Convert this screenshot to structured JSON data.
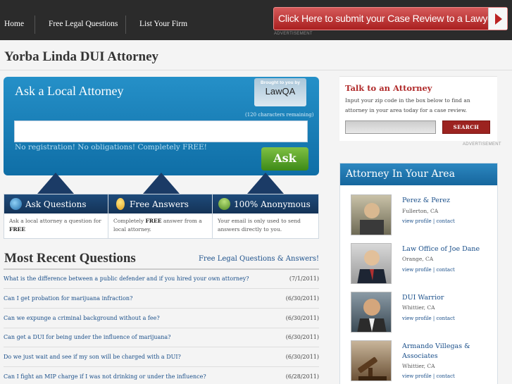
{
  "nav": {
    "items": [
      "Home",
      "Free Legal Questions",
      "List Your Firm"
    ],
    "cta_label": "Click Here to submit your Case Review to a Lawyer",
    "ad_label": "ADVERTISEMENT"
  },
  "page_title": "Yorba Linda DUI Attorney",
  "ask": {
    "heading": "Ask a Local Attorney",
    "brought_by": "Brought to you by",
    "brand": "LawQA",
    "chars_remaining": "(120 characters remaining)",
    "input_placeholder": "",
    "no_reg": "No registration! No obligations! Completely FREE!",
    "button": "Ask"
  },
  "features": [
    {
      "title": "Ask Questions",
      "body_pre": "Ask a local attorney a question for ",
      "body_bold": "FREE",
      "body_post": ""
    },
    {
      "title": "Free Answers",
      "body_pre": "Completely ",
      "body_bold": "FREE",
      "body_post": " answer from a local attorney."
    },
    {
      "title": "100% Anonymous",
      "body_pre": "Your email is only used to send answers directly to you.",
      "body_bold": "",
      "body_post": ""
    }
  ],
  "recent": {
    "heading": "Most Recent Questions",
    "link": "Free Legal Questions & Answers!",
    "questions": [
      {
        "text": "What is the difference between a public defender and if you hired your own attorney?",
        "date": "(7/1/2011)"
      },
      {
        "text": "Can I get probation for marijuana infraction?",
        "date": "(6/30/2011)"
      },
      {
        "text": "Can we expunge a criminal background without a fee?",
        "date": "(6/30/2011)"
      },
      {
        "text": "Can get a DUI for being under the influence of marijuana?",
        "date": "(6/30/2011)"
      },
      {
        "text": "Do we just wait and see if my son will be charged with a DUI?",
        "date": "(6/30/2011)"
      },
      {
        "text": "Can I fight an MIP charge if I was not drinking or under the influence?",
        "date": "(6/28/2011)"
      }
    ]
  },
  "talk": {
    "heading": "Talk to an Attorney",
    "text": "Input your zip code in the box below to find an attorney in your area today for a case review.",
    "zip_placeholder": "",
    "search_label": "SEARCH",
    "ad_label": "ADVERTISEMENT"
  },
  "area": {
    "heading": "Attorney In Your Area",
    "attorneys": [
      {
        "name": "Perez & Perez",
        "city": "Fullerton, CA",
        "links": "view profile | contact"
      },
      {
        "name": "Law Office of Joe Dane",
        "city": "Orange, CA",
        "links": "view profile | contact"
      },
      {
        "name": "DUI Warrior",
        "city": "Whittier, CA",
        "links": "view profile | contact"
      },
      {
        "name": "Armando Villegas & Associates",
        "city": "Whittier, CA",
        "links": "view profile | contact"
      }
    ]
  },
  "colors": {
    "accent_blue": "#1a7fbe",
    "cta_red": "#b22222",
    "ask_green": "#5aa52a",
    "nav_dark": "#2b2b2b"
  }
}
